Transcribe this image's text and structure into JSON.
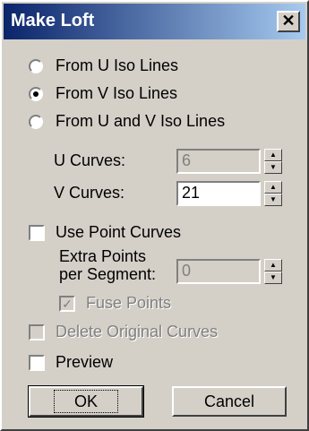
{
  "dialog": {
    "title": "Make Loft",
    "close_label": "✕"
  },
  "options": {
    "from_u": "From U Iso Lines",
    "from_v": "From V Iso Lines",
    "from_uv": "From U and V Iso Lines"
  },
  "u_curves": {
    "label": "U Curves:",
    "value": "6"
  },
  "v_curves": {
    "label": "V Curves:",
    "value": "21"
  },
  "use_point_curves": "Use Point Curves",
  "extra_points": {
    "label_line1": "Extra Points",
    "label_line2": "per Segment:",
    "value": "0"
  },
  "fuse_points": "Fuse Points",
  "fuse_check_glyph": "✓",
  "delete_original": "Delete Original Curves",
  "preview": "Preview",
  "buttons": {
    "ok": "OK",
    "cancel": "Cancel"
  },
  "spinner_glyphs": {
    "up": "▲",
    "down": "▼"
  }
}
